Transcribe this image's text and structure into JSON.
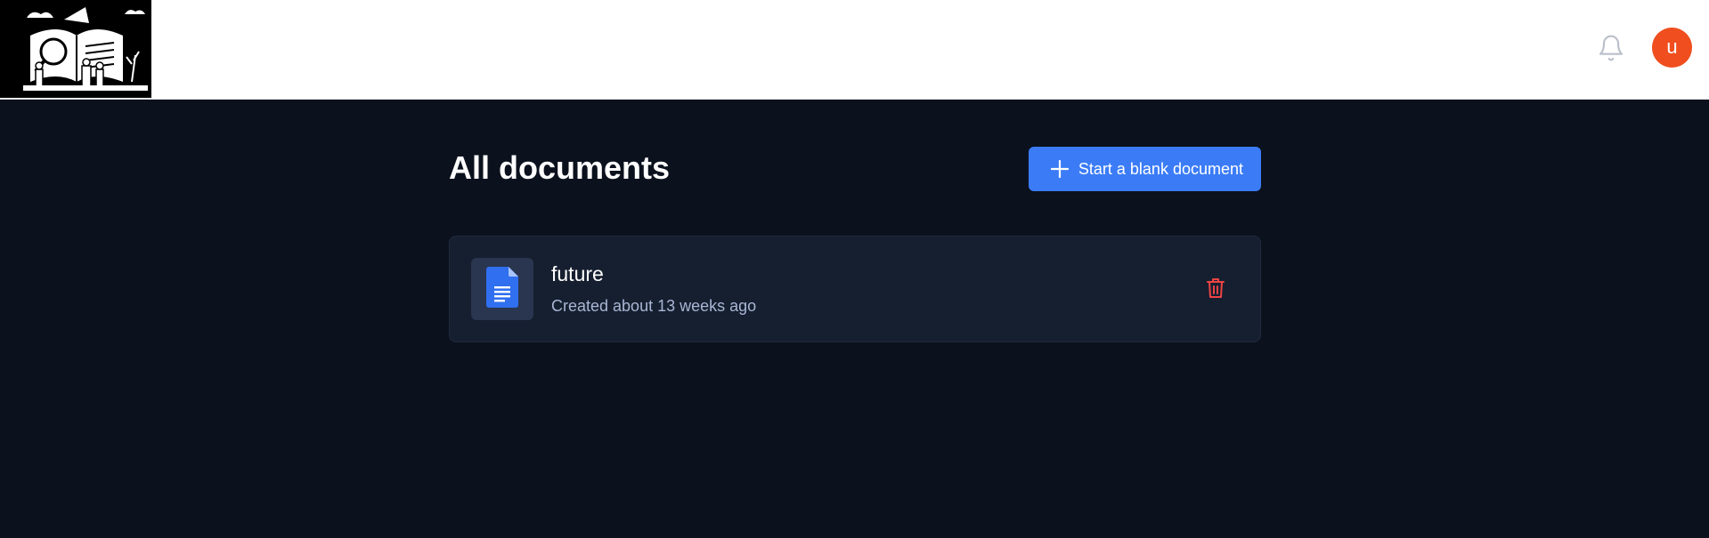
{
  "header": {
    "logo_icon": "library-illustration-logo",
    "notifications_icon": "bell-icon",
    "avatar_initial": "u",
    "avatar_color": "#f04e1f"
  },
  "main": {
    "title": "All documents",
    "new_document_label": "Start a blank document",
    "new_document_icon": "plus-icon",
    "accent_color": "#3b7cf6"
  },
  "documents": [
    {
      "name": "future",
      "created": "Created about 13 weeks ago",
      "icon": "google-docs-icon",
      "action_icon": "trash-icon",
      "action_color": "#ef4444"
    }
  ]
}
